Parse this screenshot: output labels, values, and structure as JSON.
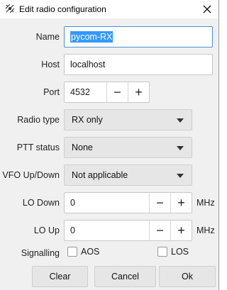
{
  "window": {
    "title": "Edit radio configuration"
  },
  "labels": {
    "name": "Name",
    "host": "Host",
    "port": "Port",
    "radio_type": "Radio type",
    "ptt_status": "PTT status",
    "vfo_updown": "VFO Up/Down",
    "lo_down": "LO Down",
    "lo_up": "LO Up",
    "signalling": "Signalling"
  },
  "fields": {
    "name": "pycom-RX",
    "host": "localhost",
    "port": "4532",
    "lo_down": "0",
    "lo_up": "0"
  },
  "selects": {
    "radio_type": "RX only",
    "ptt_status": "None",
    "vfo_updown": "Not applicable"
  },
  "units": {
    "lo_down": "MHz",
    "lo_up": "MHz"
  },
  "stepper": {
    "minus": "−",
    "plus": "+"
  },
  "checkboxes": {
    "aos": "AOS",
    "los": "LOS"
  },
  "buttons": {
    "clear": "Clear",
    "cancel": "Cancel",
    "ok": "Ok"
  }
}
